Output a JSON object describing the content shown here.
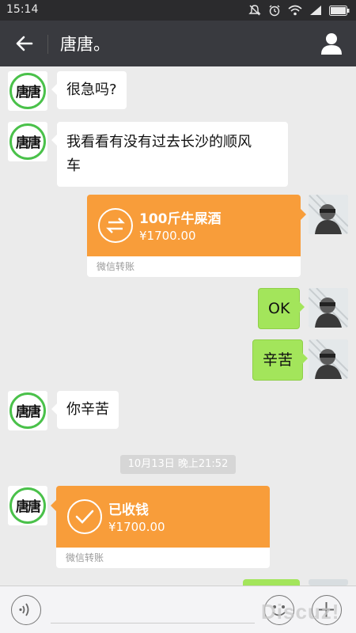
{
  "status_bar": {
    "time": "15:14",
    "icons": [
      "mute-icon",
      "alarm-icon",
      "wifi-icon",
      "signal-icon",
      "battery-icon"
    ]
  },
  "header": {
    "title": "唐唐。",
    "back_icon": "arrow-left-icon",
    "profile_icon": "person-icon"
  },
  "contact_avatar_text": "唐唐",
  "messages": {
    "m1": {
      "from": "contact",
      "text": "很急吗?"
    },
    "m2": {
      "from": "contact",
      "line1": "我看看有没有过去长沙的顺风",
      "line2": "车"
    },
    "m3": {
      "from": "me",
      "type": "transfer",
      "title": "100斤牛屎酒",
      "amount": "¥1700.00",
      "footer": "微信转账",
      "icon": "transfer-arrows-icon"
    },
    "m4": {
      "from": "me",
      "text": "OK"
    },
    "m5": {
      "from": "me",
      "text": "辛苦"
    },
    "m6": {
      "from": "contact",
      "text": "你辛苦"
    },
    "timestamp": "10月13日 晚上21:52",
    "m7": {
      "from": "contact",
      "type": "transfer",
      "title": "已收钱",
      "amount": "¥1700.00",
      "footer": "微信转账",
      "icon": "checkmark-icon"
    }
  },
  "input_bar": {
    "voice_icon": "voice-icon",
    "emoji_icon": "emoji-icon",
    "plus_icon": "plus-icon"
  },
  "watermark": "Discuz!",
  "colors": {
    "header_bg": "#393a3f",
    "chat_bg": "#ebebeb",
    "bubble_me": "#a3e55b",
    "transfer_orange": "#f89d3a",
    "avatar_ring": "#4ac14a"
  }
}
